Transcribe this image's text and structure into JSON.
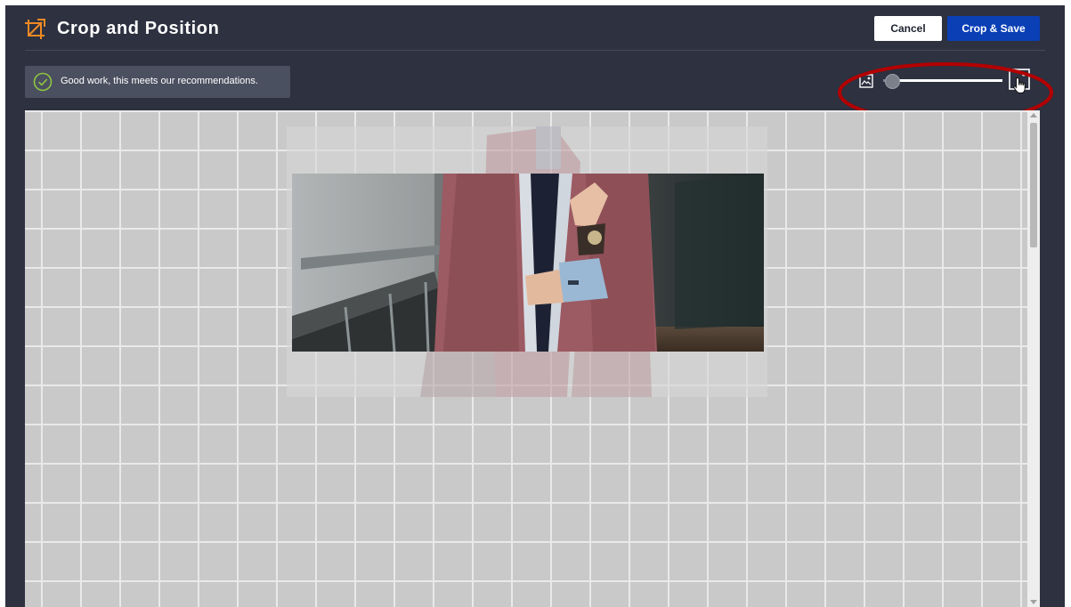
{
  "header": {
    "title": "Crop and Position",
    "cancel_label": "Cancel",
    "save_label": "Crop & Save"
  },
  "notice": {
    "text": "Good work, this meets our recommendations.",
    "status_icon": "check-circle-icon"
  },
  "zoom": {
    "min_icon": "image-small-icon",
    "max_icon": "image-large-icon",
    "level_fraction": 0.07
  },
  "colors": {
    "background": "#2d3140",
    "accent_orange": "#f08a24",
    "save_button": "#0a3fb5",
    "success_green": "#8ec63f",
    "annotation_red": "#b30000"
  }
}
